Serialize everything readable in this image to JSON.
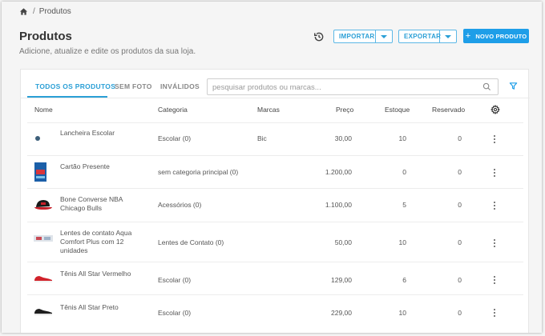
{
  "breadcrumb": {
    "current": "Produtos"
  },
  "header": {
    "title": "Produtos",
    "subtitle": "Adicione, atualize e edite os produtos da sua loja.",
    "import_label": "IMPORTAR",
    "export_label": "EXPORTAR",
    "new_product_label": "NOVO PRODUTO"
  },
  "tabs": [
    {
      "label": "TODOS OS PRODUTOS",
      "active": true
    },
    {
      "label": "SEM FOTO",
      "active": false
    },
    {
      "label": "INVÁLIDOS",
      "active": false
    }
  ],
  "search": {
    "placeholder": "pesquisar produtos ou marcas...",
    "value": ""
  },
  "table": {
    "columns": [
      "Nome",
      "Categoria",
      "Marcas",
      "Preço",
      "Estoque",
      "Reservado"
    ],
    "rows": [
      {
        "name": "Lancheira Escolar",
        "category": "Escolar (0)",
        "brand": "Bic",
        "price": "30,00",
        "stock": "10",
        "reserved": "0",
        "thumb": "dot-icon"
      },
      {
        "name": "Cartão Presente",
        "category": "sem categoria principal (0)",
        "brand": "",
        "price": "1.200,00",
        "stock": "0",
        "reserved": "0",
        "thumb": "gift-card-image"
      },
      {
        "name": "Bone Converse NBA Chicago Bulls",
        "category": "Acessórios (0)",
        "brand": "",
        "price": "1.100,00",
        "stock": "5",
        "reserved": "0",
        "thumb": "cap-image"
      },
      {
        "name": "Lentes de contato Aqua Comfort Plus com 12 unidades",
        "category": "Lentes de Contato (0)",
        "brand": "",
        "price": "50,00",
        "stock": "10",
        "reserved": "0",
        "thumb": "lens-box-image"
      },
      {
        "name": "Tênis All Star Vermelho",
        "category": "Escolar (0)",
        "brand": "",
        "price": "129,00",
        "stock": "6",
        "reserved": "0",
        "thumb": "red-sneaker-image"
      },
      {
        "name": "Tênis All Star Preto",
        "category": "Escolar (0)",
        "brand": "",
        "price": "229,00",
        "stock": "10",
        "reserved": "0",
        "thumb": "black-sneaker-image"
      }
    ]
  },
  "colors": {
    "accent": "#1e9ee8",
    "accent_text": "#2a9fd6"
  }
}
